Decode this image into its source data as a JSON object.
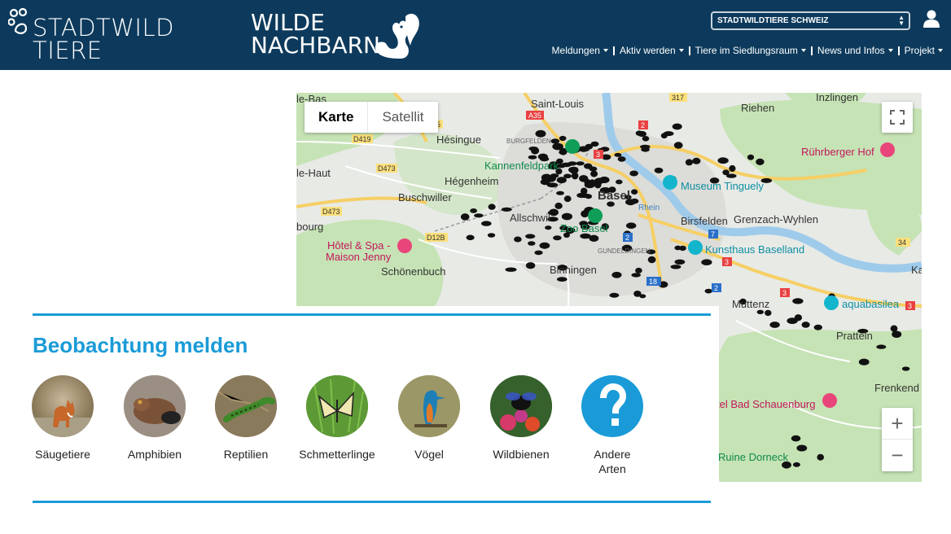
{
  "header": {
    "logo_left_line1": "STADTWILD",
    "logo_left_line2": "TIERE",
    "logo_mid_line1": "WILDE",
    "logo_mid_line2": "NACHBARN",
    "region_select_value": "STADTWILDTIERE SCHWEIZ",
    "nav": [
      {
        "label": "Meldungen"
      },
      {
        "label": "Aktiv werden"
      },
      {
        "label": "Tiere im Siedlungsraum"
      },
      {
        "label": "News und Infos"
      },
      {
        "label": "Projekt"
      }
    ],
    "colors": {
      "bg": "#0d3a5c",
      "text": "#ffffff"
    }
  },
  "map": {
    "type_control": {
      "map": "Karte",
      "satellite": "Satellit"
    },
    "zoom_in": "+",
    "zoom_out": "−",
    "labels": {
      "le_bas": "le-Bas",
      "saint_louis": "Saint-Louis",
      "inzlingen": "Inzlingen",
      "riehen": "Riehen",
      "hesingue": "Hésingue",
      "burgfelden": "BURGFELDEN",
      "kannenfeldpark": "Kannenfeldpark",
      "ruhrberger_hof": "Rührberger Hof",
      "le_haut": "le-Haut",
      "hegenheim": "Hégenheim",
      "basel": "Basel",
      "museum_tinguely": "Museum Tinguely",
      "buschwiller": "Buschwiller",
      "rhein": "Rhein",
      "allschwil": "Allschwil",
      "birsfelden": "Birsfelden",
      "grenzach_wyhlen": "Grenzach-Wyhlen",
      "bourg": "bourg",
      "zoo_basel": "Zoo Basel",
      "gundeldingen": "GUNDELDINGEN",
      "kunsthaus_baselland": "Kunsthaus Baselland",
      "hotel_spa_1": "Hôtel & Spa -",
      "hotel_spa_2": "Maison Jenny",
      "schonenbuch": "Schönenbuch",
      "binningen": "Binningen",
      "muttenz": "Muttenz",
      "aquabasilea": "aquabasilea",
      "pratteln": "Pratteln",
      "frenkend": "Frenkend",
      "bad_schauenburg": "tel Bad Schauenburg",
      "ruine_dorneck": "Ruine Dorneck",
      "kai": "Kai"
    },
    "road_badges": {
      "a35": "A35",
      "d419": "D419",
      "d473a": "D473",
      "d473b": "D473",
      "d12b": "D12B",
      "r3a": "3",
      "r2a": "2",
      "r317": "317",
      "r5": "5",
      "r7": "7",
      "r2b": "2",
      "r18": "18",
      "r3b": "3",
      "r34": "34",
      "r3c": "3",
      "r2c": "2",
      "r3d": "3",
      "r3e": "3"
    },
    "colors": {
      "land": "#e8eae6",
      "green": "#c6e3b5",
      "water": "#9fcbeb",
      "highway": "#f6cf65",
      "markers": "#111111"
    }
  },
  "report": {
    "title": "Beobachtung melden",
    "categories": [
      {
        "label": "Säugetiere",
        "icon": "fox-photo"
      },
      {
        "label": "Amphibien",
        "icon": "toad-photo"
      },
      {
        "label": "Reptilien",
        "icon": "lizard-photo"
      },
      {
        "label": "Schmetterlinge",
        "icon": "butterfly-photo"
      },
      {
        "label": "Vögel",
        "icon": "kingfisher-photo"
      },
      {
        "label": "Wildbienen",
        "icon": "bee-photo"
      },
      {
        "label": "Andere Arten",
        "icon": "question-icon"
      }
    ],
    "accent": "#1a9bd7"
  }
}
